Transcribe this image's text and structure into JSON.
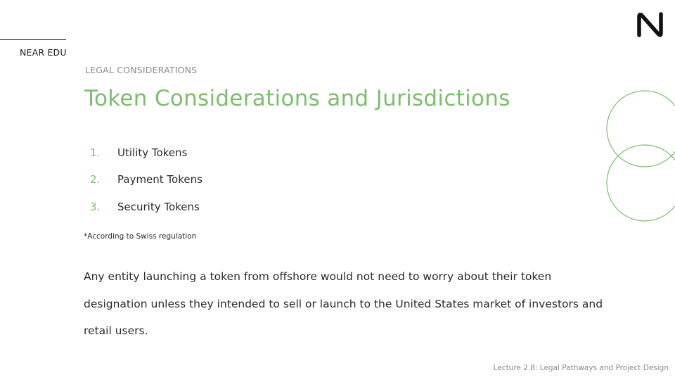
{
  "header": {
    "brand": "NEAR EDU",
    "logo_icon": "near-logo-icon"
  },
  "slide": {
    "section_label": "LEGAL CONSIDERATIONS",
    "title": "Token Considerations and Jurisdictions",
    "list": [
      {
        "number": "1.",
        "label": "Utility Tokens"
      },
      {
        "number": "2.",
        "label": "Payment Tokens"
      },
      {
        "number": "3.",
        "label": "Security Tokens"
      }
    ],
    "note": "*According to Swiss regulation",
    "body": "Any entity launching a token from offshore would not need to worry about their token designation unless they intended to sell or launch to the United States market of investors and retail users."
  },
  "footer": {
    "lecture": "Lecture 2.8: Legal Pathways and Project Design"
  },
  "colors": {
    "accent": "#7cbf6d",
    "text": "#2b2b2b",
    "muted": "#8a8a8a"
  }
}
